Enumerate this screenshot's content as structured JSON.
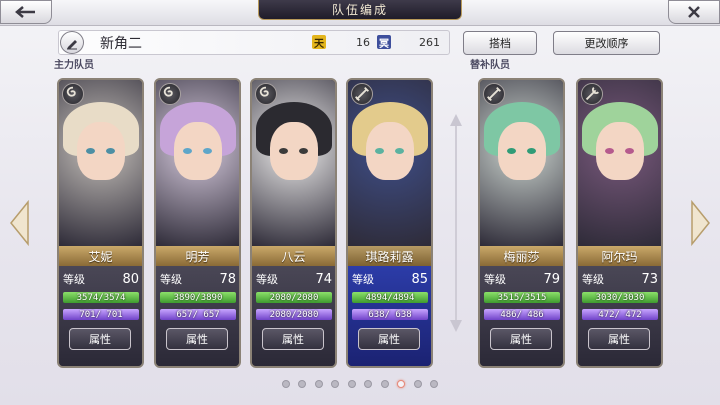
{
  "header": {
    "title": "队伍编成",
    "back_icon": "back-arrow-icon",
    "close_icon": "close-x-icon"
  },
  "team": {
    "name": "新角二",
    "stat1_label": "天",
    "stat1_value": "16",
    "stat2_label": "冥",
    "stat2_value": "261"
  },
  "buttons": {
    "partner": "搭档",
    "reorder": "更改顺序"
  },
  "sections": {
    "main": "主力队员",
    "sub": "替补队员"
  },
  "characters": [
    {
      "name": "艾妮",
      "level_label": "等级",
      "level": "80",
      "hp": "3574/3574",
      "mp": "701/ 701",
      "hp_pct": 1.0,
      "mp_pct": 1.0,
      "attr_button": "属性",
      "type_icon": "swirl-icon",
      "palette": {
        "bg": "#c8c3bd",
        "hair": "#e8dcc7",
        "eye": "#4d8fa4"
      }
    },
    {
      "name": "明芳",
      "level_label": "等级",
      "level": "78",
      "hp": "3890/3890",
      "mp": "657/ 657",
      "hp_pct": 1.0,
      "mp_pct": 1.0,
      "attr_button": "属性",
      "type_icon": "swirl-icon",
      "palette": {
        "bg": "#d9cde0",
        "hair": "#c6a4d9",
        "eye": "#5ea6c9"
      }
    },
    {
      "name": "八云",
      "level_label": "等级",
      "level": "74",
      "hp": "2080/2080",
      "mp": "2080/2080",
      "hp_pct": 1.0,
      "mp_pct": 1.0,
      "attr_button": "属性",
      "type_icon": "swirl-icon",
      "palette": {
        "bg": "#f1f0ef",
        "hair": "#2b2a30",
        "eye": "#3b3b3b"
      }
    },
    {
      "name": "琪路莉露",
      "level_label": "等级",
      "level": "85",
      "hp": "4894/4894",
      "mp": "638/ 638",
      "hp_pct": 1.0,
      "mp_pct": 1.0,
      "attr_button": "属性",
      "type_icon": "sword-icon",
      "palette": {
        "bg": "#3f4f8a",
        "hair": "#e3cb8c",
        "eye": "#5bb2a0"
      }
    },
    {
      "name": "梅丽莎",
      "level_label": "等级",
      "level": "79",
      "hp": "3515/3515",
      "mp": "486/ 486",
      "hp_pct": 1.0,
      "mp_pct": 1.0,
      "attr_button": "属性",
      "type_icon": "sword-icon",
      "palette": {
        "bg": "#cfd8d2",
        "hair": "#7ec7a4",
        "eye": "#2f9c77"
      }
    },
    {
      "name": "阿尔玛",
      "level_label": "等级",
      "level": "73",
      "hp": "3030/3030",
      "mp": "472/ 472",
      "hp_pct": 1.0,
      "mp_pct": 1.0,
      "attr_button": "属性",
      "type_icon": "staff-icon",
      "palette": {
        "bg": "#7b5a7e",
        "hair": "#9fd39b",
        "eye": "#b55a8d"
      }
    }
  ],
  "pagination": {
    "count": 10,
    "active": 8
  }
}
